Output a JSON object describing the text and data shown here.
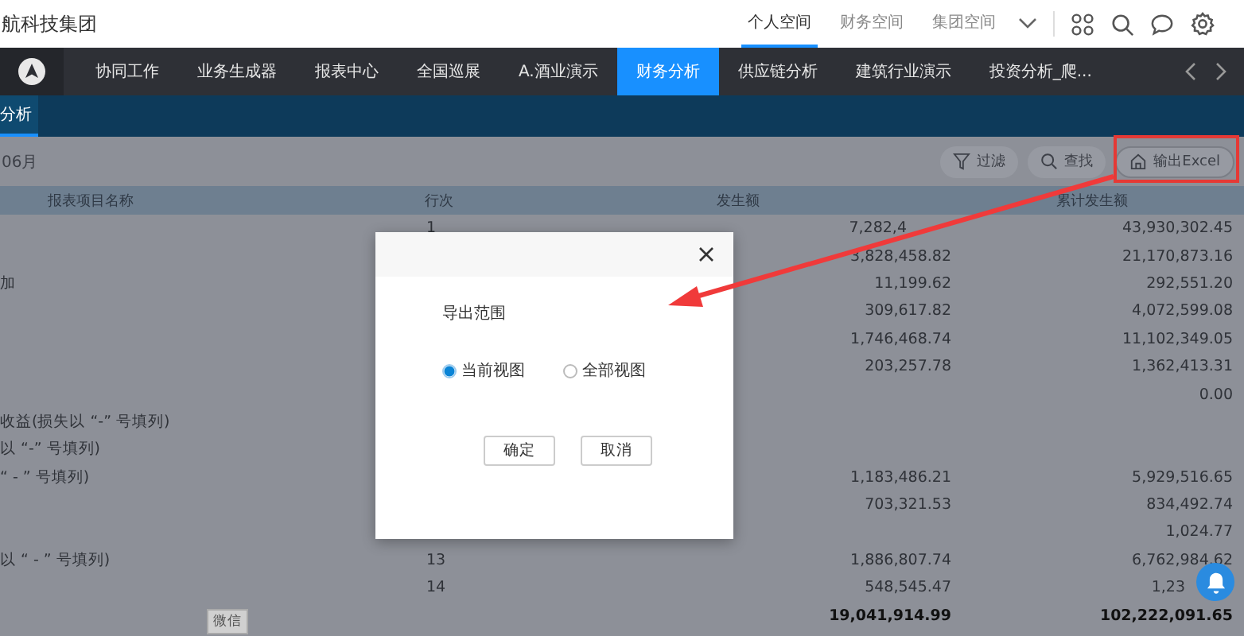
{
  "header": {
    "company": "航科技集团",
    "spaces": [
      {
        "label": "个人空间",
        "selected": true
      },
      {
        "label": "财务空间",
        "selected": false
      },
      {
        "label": "集团空间",
        "selected": false
      }
    ]
  },
  "nav": {
    "items": [
      {
        "label": "协同工作",
        "selected": false
      },
      {
        "label": "业务生成器",
        "selected": false
      },
      {
        "label": "报表中心",
        "selected": false
      },
      {
        "label": "全国巡展",
        "selected": false
      },
      {
        "label": "A.酒业演示",
        "selected": false
      },
      {
        "label": "财务分析",
        "selected": true
      },
      {
        "label": "供应链分析",
        "selected": false
      },
      {
        "label": "建筑行业演示",
        "selected": false
      },
      {
        "label": "投资分析_爬...",
        "selected": false
      }
    ]
  },
  "subtab": {
    "label": "分析",
    "selected": true
  },
  "toolbar": {
    "period": "06月",
    "buttons": [
      {
        "kind": "filter",
        "label": "过滤",
        "highlighted": false
      },
      {
        "kind": "search",
        "label": "查找",
        "highlighted": false
      },
      {
        "kind": "export",
        "label": "输出Excel",
        "highlighted": true
      }
    ]
  },
  "table": {
    "columns": [
      "报表项目名称",
      "行次",
      "发生额",
      "累计发生额"
    ],
    "rows": [
      [
        "",
        "1",
        "7,282,4",
        "43,930,302.45"
      ],
      [
        "",
        "",
        "3,828,458.82",
        "21,170,873.16"
      ],
      [
        "加",
        "",
        "11,199.62",
        "292,551.20"
      ],
      [
        "",
        "",
        "309,617.82",
        "4,072,599.08"
      ],
      [
        "",
        "",
        "1,746,468.74",
        "11,102,349.05"
      ],
      [
        "",
        "",
        "203,257.78",
        "1,362,413.31"
      ],
      [
        "",
        "",
        "",
        "0.00"
      ],
      [
        "收益(损失以 “-” 号填列)",
        "",
        "",
        ""
      ],
      [
        "以 “-” 号填列)",
        "",
        "",
        ""
      ],
      [
        "“ - ” 号填列)",
        "",
        "1,183,486.21",
        "5,929,516.65"
      ],
      [
        "",
        "",
        "703,321.53",
        "834,492.74"
      ],
      [
        "",
        "",
        "",
        "1,024.77"
      ],
      [
        "以 “ - ” 号填列)",
        "13",
        "1,886,807.74",
        "6,762,984.62"
      ],
      [
        "",
        "14",
        "548,545.47",
        "1,23"
      ]
    ],
    "total": {
      "amount": "19,041,914.99",
      "cumulative": "102,222,091.65"
    }
  },
  "dialog": {
    "section": "导出范围",
    "options": [
      {
        "label": "当前视图",
        "selected": true
      },
      {
        "label": "全部视图",
        "selected": false
      }
    ],
    "buttons": [
      "确定",
      "取消"
    ]
  },
  "tooltip": "微信"
}
